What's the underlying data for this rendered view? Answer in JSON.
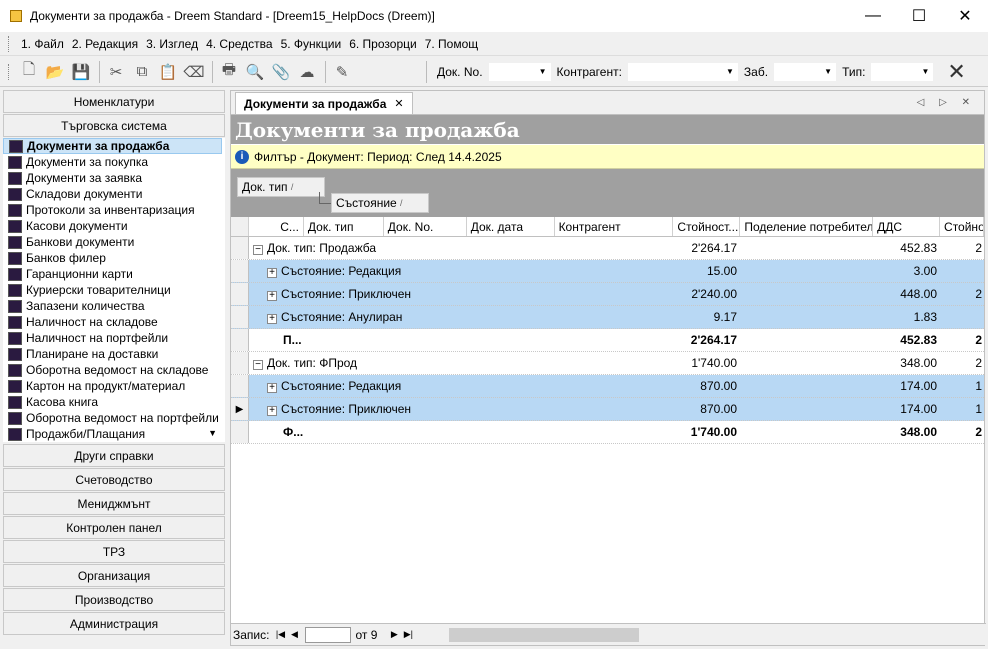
{
  "window": {
    "title": "Документи за продажба - Dreem Standard - [Dreem15_HelpDocs (Dreem)]",
    "minimize": "—",
    "maximize": "☐",
    "close": "✕"
  },
  "menu": [
    "1. Файл",
    "2. Редакция",
    "3. Изглед",
    "4. Средства",
    "5. Функции",
    "6. Прозорци",
    "7. Помощ"
  ],
  "toolbar": {
    "doc_no_label": "Док. No.",
    "counterparty_label": "Контрагент:",
    "note_label": "Заб.",
    "type_label": "Тип:",
    "dropdown_arrow": "▼"
  },
  "left_panel": {
    "headers_top": [
      "Номенклатури",
      "Търговска система"
    ],
    "nav_items": [
      "Документи за продажба",
      "Документи за покупка",
      "Документи за заявка",
      "Складови документи",
      "Протоколи за инвентаризация",
      "Касови документи",
      "Банкови документи",
      "Банков филер",
      "Гаранционни карти",
      "Куриерски товарителници",
      "Запазени количества",
      "Наличност на складове",
      "Наличност на портфейли",
      "Планиране на доставки",
      "Оборотна ведомост на складове",
      "Картон на продукт/материал",
      "Касова книга",
      "Оборотна ведомост на портфейли",
      "Продажби/Плащания"
    ],
    "headers_bottom": [
      "Други справки",
      "Счетоводство",
      "Мениджмънт",
      "Контролен панел",
      "ТРЗ",
      "Организация",
      "Производство",
      "Администрация"
    ]
  },
  "tab": {
    "label": "Документи за продажба",
    "close": "✕",
    "controls": "◁ ▷ ✕"
  },
  "page_title": "Документи за продажба",
  "filter": {
    "icon": "i",
    "text": "Филтър - Документ: Период: След 14.4.2025"
  },
  "group_buttons": [
    "Док. тип",
    "Състояние"
  ],
  "grid": {
    "columns": [
      "С...",
      "Док. тип",
      "Док. No.",
      "Док. дата",
      "Контрагент",
      "Стойност...",
      "Поделение потребител",
      "ДДС",
      "Стойно"
    ],
    "rows": [
      {
        "label": "Док. тип: Продажба",
        "value": "2'264.17",
        "vat": "452.83",
        "extra": "2",
        "level": 0,
        "kind": "group"
      },
      {
        "label": "Състояние: Редакция",
        "value": "15.00",
        "vat": "3.00",
        "extra": "",
        "level": 1,
        "kind": "sub"
      },
      {
        "label": "Състояние: Приключен",
        "value": "2'240.00",
        "vat": "448.00",
        "extra": "2",
        "level": 1,
        "kind": "sub"
      },
      {
        "label": "Състояние: Анулиран",
        "value": "9.17",
        "vat": "1.83",
        "extra": "",
        "level": 1,
        "kind": "sub"
      },
      {
        "label": "П...",
        "value": "2'264.17",
        "vat": "452.83",
        "extra": "2",
        "level": 1,
        "kind": "total"
      },
      {
        "label": "Док. тип: ФПрод",
        "value": "1'740.00",
        "vat": "348.00",
        "extra": "2",
        "level": 0,
        "kind": "group"
      },
      {
        "label": "Състояние: Редакция",
        "value": "870.00",
        "vat": "174.00",
        "extra": "1",
        "level": 1,
        "kind": "sub"
      },
      {
        "label": "Състояние: Приключен",
        "value": "870.00",
        "vat": "174.00",
        "extra": "1",
        "level": 1,
        "kind": "sub",
        "current": true
      },
      {
        "label": "Ф...",
        "value": "1'740.00",
        "vat": "348.00",
        "extra": "2",
        "level": 1,
        "kind": "total"
      }
    ]
  },
  "status": {
    "records_label": "Запис:",
    "of_label": "от 9",
    "first": "|◀",
    "prev": "◀",
    "next": "▶",
    "last": "▶|"
  },
  "icons": [
    "new-file-icon",
    "open-folder-icon",
    "save-icon",
    "cut-icon",
    "copy-icon",
    "paste-icon",
    "eraser-icon",
    "print-icon",
    "preview-icon",
    "attach-icon",
    "upload-icon",
    "edit-icon",
    "close-icon",
    "info-icon",
    "expand-icon",
    "collapse-icon"
  ]
}
